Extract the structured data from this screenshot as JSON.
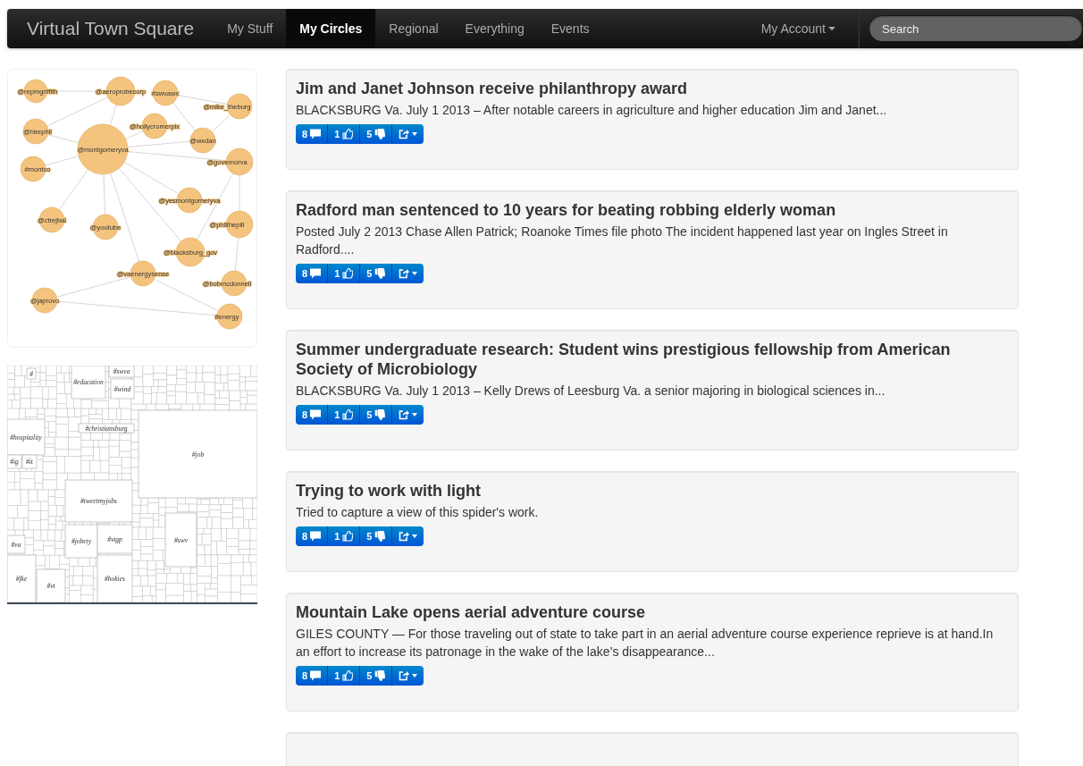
{
  "navbar": {
    "brand": "Virtual Town Square",
    "items": [
      {
        "label": "My Stuff",
        "selected": false
      },
      {
        "label": "My Circles",
        "selected": true
      },
      {
        "label": "Regional",
        "selected": false
      },
      {
        "label": "Everything",
        "selected": false
      },
      {
        "label": "Events",
        "selected": false
      }
    ],
    "account": "My Account",
    "search": {
      "placeholder": "Search"
    }
  },
  "network": {
    "nodes": [
      "@repmgriffith",
      "@aeroprobecorp",
      "#swvawx",
      "@mike_theburg",
      "@hirephil",
      "@hollycromerpix",
      "@wxdan",
      "@montgomeryva",
      "@governorva",
      "#montco",
      "@ctrejbal",
      "@youtube",
      "@yesmontgomeryva",
      "@philthepill",
      "@blacksburg_gov",
      "@vaenergysense",
      "@bobmcdonnell",
      "@japrovo",
      "#energy"
    ]
  },
  "treemap": {
    "labels": [
      "#",
      "#education",
      "#swva",
      "#wind",
      "#christiansburg",
      "#hospitality",
      "#ig",
      "#it",
      "#job",
      "#tweetmyjobs",
      "#va",
      "#jobety",
      "#vtgp",
      "#swv",
      "#fke",
      "#vt",
      "#hokies"
    ]
  },
  "articles": [
    {
      "title": "Jim and Janet Johnson receive philanthropy award",
      "summary": "BLACKSBURG Va. July 1 2013 – After notable careers in agriculture and higher education Jim and Janet...",
      "comments": "8",
      "likes": "1",
      "dislikes": "5"
    },
    {
      "title": "Radford man sentenced to 10 years for beating robbing elderly woman",
      "summary": "Posted July 2 2013 Chase Allen Patrick; Roanoke Times file photo The incident happened last year on Ingles Street in Radford....",
      "comments": "8",
      "likes": "1",
      "dislikes": "5"
    },
    {
      "title": "Summer undergraduate research: Student wins prestigious fellowship from American Society of Microbiology",
      "summary": "BLACKSBURG Va. July 1 2013 – Kelly Drews of Leesburg Va. a senior majoring in biological sciences in...",
      "comments": "8",
      "likes": "1",
      "dislikes": "5"
    },
    {
      "title": "Trying to work with light",
      "summary": "Tried to capture a view of this spider's work.",
      "comments": "8",
      "likes": "1",
      "dislikes": "5"
    },
    {
      "title": "Mountain Lake opens aerial adventure course",
      "summary": "GILES COUNTY — For those traveling out of state to take part in an aerial adventure course experience reprieve is at hand.In an effort to increase its patronage in the wake of the lake’s disappearance...",
      "comments": "8",
      "likes": "1",
      "dislikes": "5"
    }
  ],
  "more_below": true
}
